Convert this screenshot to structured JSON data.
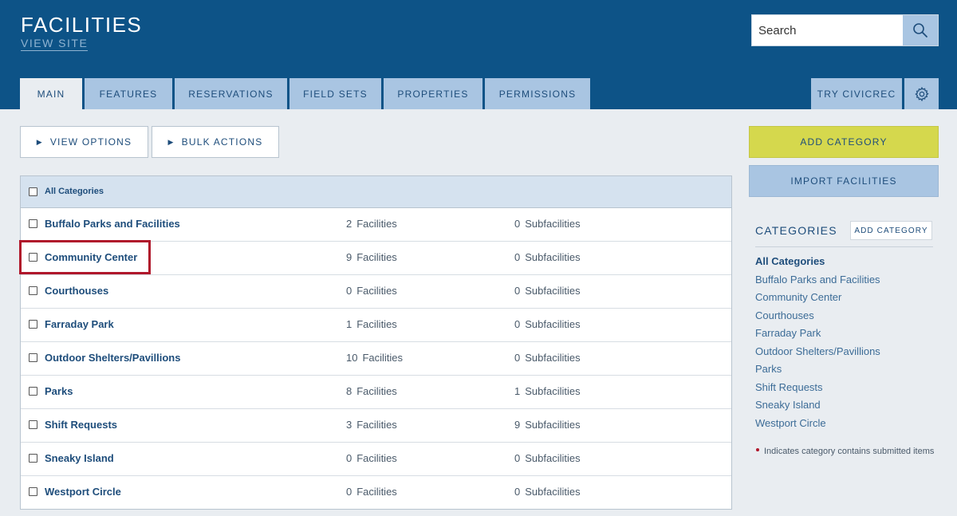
{
  "header": {
    "title": "FACILITIES",
    "view_site": "VIEW SITE",
    "search_placeholder": "Search",
    "search_icon": "search-icon"
  },
  "tabs": [
    {
      "label": "MAIN",
      "active": true
    },
    {
      "label": "FEATURES",
      "active": false
    },
    {
      "label": "RESERVATIONS",
      "active": false
    },
    {
      "label": "FIELD SETS",
      "active": false
    },
    {
      "label": "PROPERTIES",
      "active": false
    },
    {
      "label": "PERMISSIONS",
      "active": false
    }
  ],
  "tab_try": "TRY CIVICREC",
  "settings_icon": "gear-icon",
  "toolbar": {
    "view_options": "VIEW OPTIONS",
    "bulk_actions": "BULK ACTIONS"
  },
  "table": {
    "header_label": "All Categories",
    "facilities_word": "Facilities",
    "subfacilities_word": "Subfacilities",
    "rows": [
      {
        "name": "Buffalo Parks and Facilities",
        "facilities": "2",
        "subfacilities": "0"
      },
      {
        "name": "Community Center",
        "facilities": "9",
        "subfacilities": "0"
      },
      {
        "name": "Courthouses",
        "facilities": "0",
        "subfacilities": "0"
      },
      {
        "name": "Farraday Park",
        "facilities": "1",
        "subfacilities": "0"
      },
      {
        "name": "Outdoor Shelters/Pavillions",
        "facilities": "10",
        "subfacilities": "0"
      },
      {
        "name": "Parks",
        "facilities": "8",
        "subfacilities": "1"
      },
      {
        "name": "Shift Requests",
        "facilities": "3",
        "subfacilities": "9"
      },
      {
        "name": "Sneaky Island",
        "facilities": "0",
        "subfacilities": "0"
      },
      {
        "name": "Westport Circle",
        "facilities": "0",
        "subfacilities": "0"
      }
    ]
  },
  "sidebar": {
    "add_category": "ADD CATEGORY",
    "import_facilities": "IMPORT FACILITIES",
    "categories_heading": "CATEGORIES",
    "categories_add": "ADD CATEGORY",
    "categories": [
      "All Categories",
      "Buffalo Parks and Facilities",
      "Community Center",
      "Courthouses",
      "Farraday Park",
      "Outdoor Shelters/Pavillions",
      "Parks",
      "Shift Requests",
      "Sneaky Island",
      "Westport Circle"
    ],
    "note": "Indicates category contains submitted items"
  },
  "colors": {
    "header_bg": "#0d5387",
    "tab_bg": "#a9c5e2",
    "accent_yellow": "#d5d84d",
    "highlight_red": "#b0172b"
  }
}
